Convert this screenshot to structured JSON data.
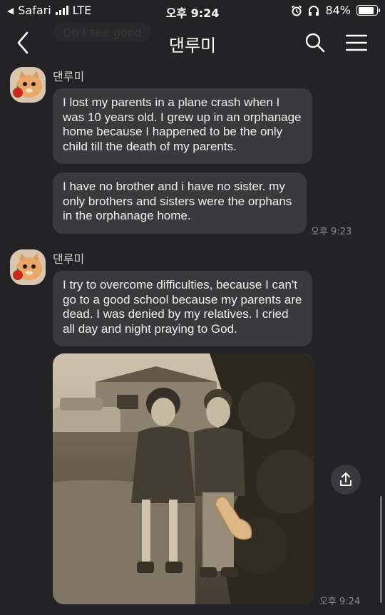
{
  "status_bar": {
    "back_app": "Safari",
    "network": "LTE",
    "time": "오후 9:24",
    "battery": "84%",
    "battery_level": 0.84
  },
  "header": {
    "title": "댄루미",
    "previous_message": "Oh I see good"
  },
  "messages": [
    {
      "sender": "댄루미",
      "bubbles": [
        "I lost my  parents in a plane crash when I was 10 years  old. I grew up in an orphanage home because I happened to  be the only child till the death of my parents.",
        "I have no brother and i have no sister. my only brothers  and sisters were the orphans in the orphanage home."
      ],
      "time": "오후 9:23"
    },
    {
      "sender": "댄루미",
      "bubbles": [
        "I try to overcome difficulties, because I can't go to a  good school because  my parents are dead. I was denied by  my relatives. I cried all day and night praying to God."
      ],
      "photo": "vintage-children-photo",
      "time": "오후 9:24"
    }
  ],
  "icons": {
    "back": "chevron-left-icon",
    "search": "search-icon",
    "menu": "hamburger-menu-icon",
    "share": "share-icon"
  },
  "colors": {
    "background": "#232325",
    "bubble": "#3a3a3d"
  }
}
